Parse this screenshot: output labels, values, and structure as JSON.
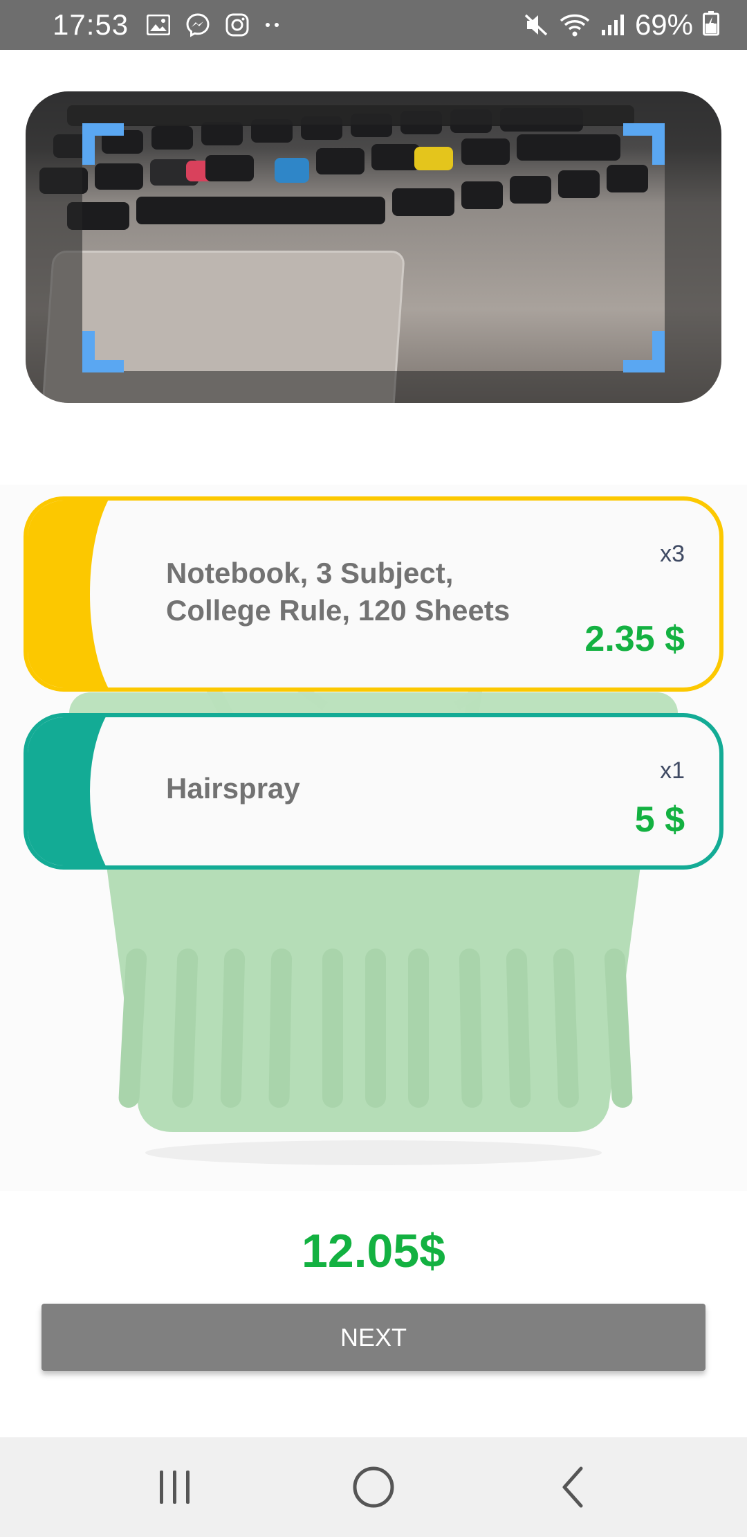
{
  "status_bar": {
    "time": "17:53",
    "battery": "69%",
    "left_icons": [
      "gallery-icon",
      "messenger-icon",
      "instagram-icon",
      "more-dots-icon"
    ],
    "right_icons": [
      "mute-icon",
      "wifi-icon",
      "signal-icon",
      "battery-charging-icon"
    ]
  },
  "scanner": {
    "frame_color": "#5aa7f2"
  },
  "items": [
    {
      "name": "Notebook, 3 Subject, College Rule, 120 Sheets",
      "quantity": "x3",
      "price": "2.35 $",
      "color": "#fcc800"
    },
    {
      "name": "Hairspray",
      "quantity": "x1",
      "price": "5 $",
      "color": "#13ab95"
    }
  ],
  "total": "12.05$",
  "next_label": "NEXT",
  "colors": {
    "price_green": "#13b141",
    "button_gray": "#808080"
  },
  "nav_bar": [
    "recents-icon",
    "home-icon",
    "back-icon"
  ]
}
